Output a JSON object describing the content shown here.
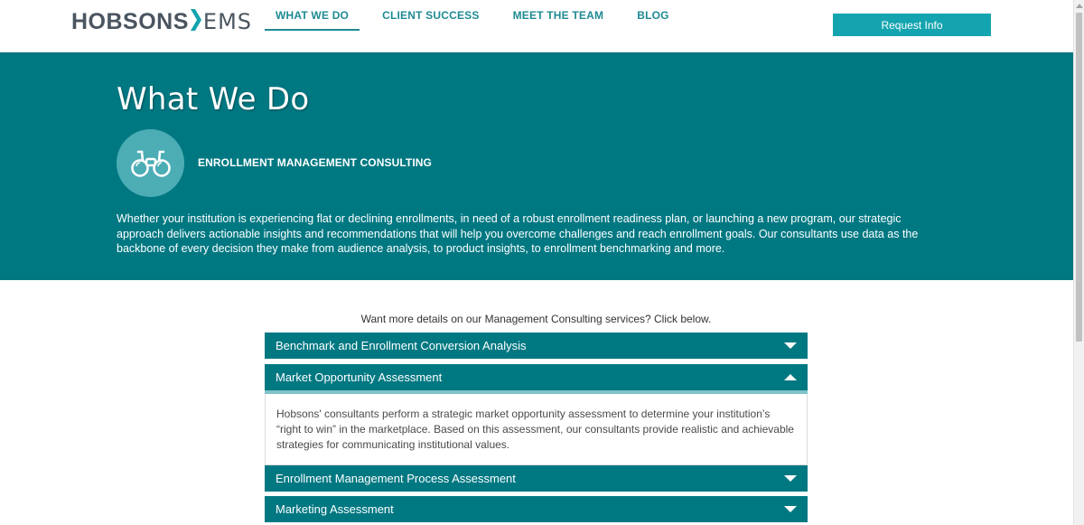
{
  "brand": {
    "name_main": "HOBSONS",
    "name_sub": "EMS",
    "text_color": "#4a5560",
    "accent_color": "#14a4b0"
  },
  "nav": {
    "items": [
      {
        "label": "WHAT WE DO",
        "active": true
      },
      {
        "label": "CLIENT SUCCESS",
        "active": false
      },
      {
        "label": "MEET THE TEAM",
        "active": false
      },
      {
        "label": "BLOG",
        "active": false
      }
    ],
    "cta_label": "Request Info"
  },
  "hero": {
    "title": "What We Do",
    "icon": "binoculars-icon",
    "service_title": "ENROLLMENT MANAGEMENT CONSULTING",
    "description": "Whether your institution is experiencing flat or declining enrollments, in need of a robust enrollment readiness plan, or launching a new program, our strategic approach delivers actionable insights and recommendations that will help you overcome challenges and reach enrollment goals. Our consultants use data as the backbone of every decision they make from audience analysis, to product insights, to enrollment benchmarking and more.",
    "background_color": "#007882"
  },
  "services": {
    "intro": "Want more details on our Management Consulting services? Click below.",
    "items": [
      {
        "title": "Benchmark and Enrollment Conversion Analysis",
        "expanded": false
      },
      {
        "title": "Market Opportunity Assessment",
        "expanded": true,
        "body": "Hobsons' consultants perform a strategic market opportunity assessment to determine your institution’s “right to win” in the marketplace. Based on this assessment, our consultants provide realistic and achievable strategies for communicating institutional values."
      },
      {
        "title": "Enrollment Management Process Assessment",
        "expanded": false
      },
      {
        "title": "Marketing Assessment",
        "expanded": false
      }
    ]
  }
}
